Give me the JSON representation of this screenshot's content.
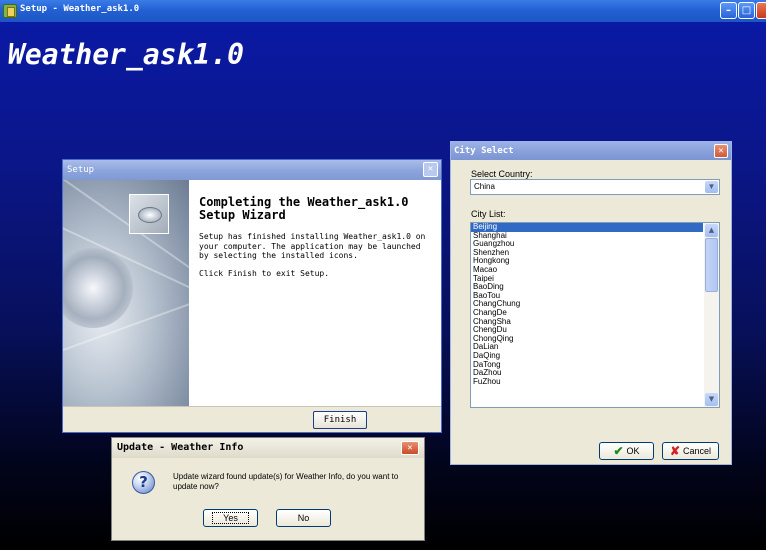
{
  "main_window": {
    "title": "Setup - Weather_ask1.0",
    "heading": "Weather_ask1.0",
    "icons": {
      "app": "setup-app-icon",
      "minimize": "minimize-icon",
      "maximize": "maximize-icon",
      "close": "close-icon"
    }
  },
  "setup_dialog": {
    "title": "Setup",
    "heading": "Completing the Weather_ask1.0 Setup Wizard",
    "paragraph1": "Setup has finished installing Weather_ask1.0 on your computer. The application may be launched by selecting the installed icons.",
    "paragraph2": "Click Finish to exit Setup.",
    "finish_label": "Finish",
    "close_symbol": "✕"
  },
  "city_dialog": {
    "title": "City Select",
    "country_label": "Select Country:",
    "country_value": "China",
    "list_label": "City List:",
    "cities": [
      "Beijing",
      "Shanghai",
      "Guangzhou",
      "Shenzhen",
      "Hongkong",
      "Macao",
      "Taipei",
      "BaoDing",
      "BaoTou",
      "ChangChung",
      "ChangDe",
      "ChangSha",
      "ChengDu",
      "ChongQing",
      "DaLian",
      "DaQing",
      "DaTong",
      "DaZhou",
      "FuZhou"
    ],
    "selected_index": 0,
    "ok_label": "OK",
    "cancel_label": "Cancel",
    "close_symbol": "✕",
    "icons": {
      "ok": "checkmark-icon",
      "cancel": "red-x-icon"
    }
  },
  "update_dialog": {
    "title": "Update - Weather Info",
    "message": "Update wizard found update(s) for Weather Info, do you want to update now?",
    "yes_label": "Yes",
    "no_label": "No",
    "close_symbol": "✕",
    "icons": {
      "question": "question-icon"
    }
  },
  "colors": {
    "desktop_top": "#0a1aa8",
    "desktop_bottom": "#000000",
    "titlebar": "#2261d4",
    "selection": "#316ac5",
    "dialog_face": "#ece9d8"
  }
}
